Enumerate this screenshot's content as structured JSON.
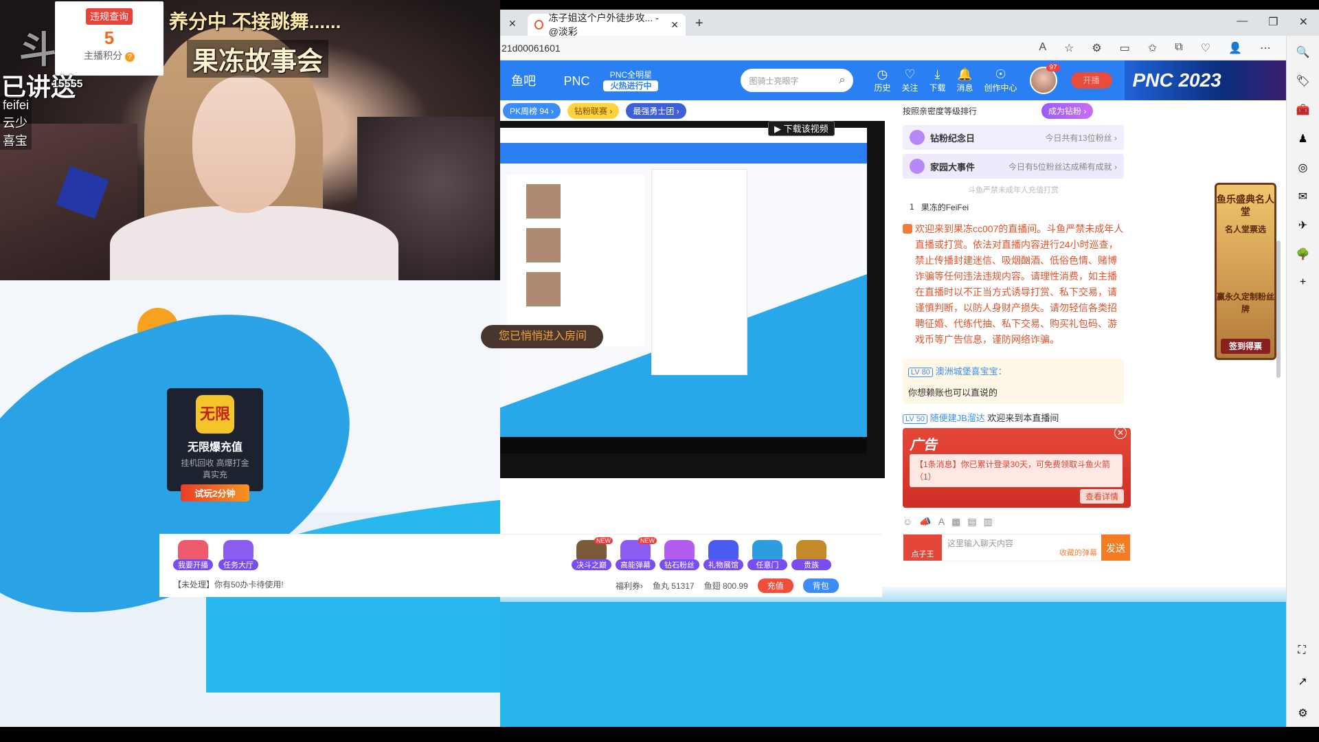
{
  "overlay": {
    "violation_tag": "违规查询",
    "score": "5",
    "score_label": "主播积分",
    "score_help": "?",
    "top_text": "养分中 不接跳舞......",
    "title_text": "果冻故事会",
    "left_text": "已讲送",
    "logo_text": "斗",
    "room_id_text": "15555",
    "names": [
      "feifei",
      "云少",
      "喜宝"
    ]
  },
  "browser": {
    "tab_title": "冻子姐这个户外徒步攻... - @淡彩",
    "new_tab": "+",
    "window_controls": [
      "—",
      "❐",
      "✕"
    ],
    "url": "21d00061601",
    "toolbar_icons": [
      "A",
      "☆",
      "⚙",
      "▭",
      "✩",
      "⧉",
      "♡",
      "👤",
      "⋯"
    ],
    "side_icons": [
      "🔍",
      "🏷",
      "🧰",
      "♟",
      "◎",
      "✉",
      "✈",
      "🌳",
      "+"
    ],
    "side_bottom_icons": [
      "⛶",
      "↗",
      "⚙"
    ]
  },
  "header": {
    "nav": [
      "鱼吧",
      "PNC"
    ],
    "pnc_top": "PNC全明星",
    "pnc_hot": "火热进行中",
    "search_placeholder": "图骑士亮眼字",
    "hnav": [
      {
        "icon": "◷",
        "label": "历史"
      },
      {
        "icon": "♡",
        "label": "关注"
      },
      {
        "icon": "⤓",
        "label": "下载"
      },
      {
        "icon": "🔔",
        "label": "消息"
      },
      {
        "icon": "☉",
        "label": "创作中心"
      }
    ],
    "avatar_badge": "97",
    "live_btn": "开播",
    "banner": "PNC 2023"
  },
  "subbar": {
    "chips": [
      "PK周榜 94 ›",
      "钻粉联赛 ›",
      "最强勇士团 ›"
    ]
  },
  "video": {
    "download_label": "▶ 下载该视频",
    "room_toast": "您已悄悄进入房间"
  },
  "promo_card": {
    "logo": "无限",
    "title": "无限爆充值",
    "line1": "挂机回收  高爆打金",
    "line2": "真实充",
    "cta": "试玩2分钟"
  },
  "rank": {
    "head": "按照亲密度等级排行",
    "become": "成为钻粉 ›",
    "rows": [
      {
        "title": "钻粉纪念日",
        "sub": "今日共有13位粉丝 ›"
      },
      {
        "title": "家园大事件",
        "sub": "今日有5位粉丝达成稀有成就 ›"
      }
    ],
    "note": "斗鱼严禁未成年人充值打赏",
    "first_rank": "1",
    "first_name": "果冻的FeiFei"
  },
  "chat": {
    "notice": "欢迎来到果冻cc007的直播间。斗鱼严禁未成年人直播或打赏。依法对直播内容进行24小时巡查，禁止传播封建迷信、吸烟酗酒、低俗色情、赌博诈骗等任何违法违规内容。请理性消费，如主播在直播时以不正当方式诱导打赏、私下交易，请谨慎判断，以防人身财产损失。请勿轻信各类招聘征婚、代练代抽、私下交易、购买礼包码、游戏币等广告信息，谨防网络诈骗。",
    "msg1": {
      "lv": "LV 80",
      "nick": "澳洲城堡喜宝宝：",
      "text": "你想赖账也可以直说的"
    },
    "msg2": {
      "lv": "LV 50",
      "nick": "随便建JB溜达",
      "text": "欢迎来到本直播间"
    },
    "ad_title": "广告",
    "ad_close": "✕",
    "ad_text": "【1条消息】你已累计登录30天，可免费领取斗鱼火箭（1）",
    "ad_btn": "查看详情",
    "input_tools": [
      "☺",
      "📣",
      "A",
      "▦",
      "▤",
      "▥"
    ],
    "input_placeholder": "这里输入聊天内容",
    "input_fav": "收藏的弹幕",
    "send": "发送",
    "badge": "点子王"
  },
  "event_banner": {
    "title": "鱼乐盛典名人堂",
    "sub": "名人堂票选",
    "badge": "赢永久定制粉丝牌",
    "cta": "签到得票"
  },
  "bottom": {
    "gifts_left": [
      {
        "label": "我要开播",
        "color": "#f05a6d"
      },
      {
        "label": "任务大厅",
        "color": "#8a5cf0"
      }
    ],
    "gifts_right": [
      {
        "label": "决斗之巅",
        "color": "#7b5a3a",
        "new": "NEW"
      },
      {
        "label": "高能弹幕",
        "color": "#8a5cf0",
        "new": "NEW"
      },
      {
        "label": "钻石粉丝",
        "color": "#b45cf0",
        "new": ""
      },
      {
        "label": "礼物展馆",
        "color": "#4a5cf0",
        "new": ""
      },
      {
        "label": "任意门",
        "color": "#2c9ee0",
        "new": ""
      },
      {
        "label": "贵族",
        "color": "#c38a2a",
        "new": ""
      }
    ],
    "notice": "【未处理】你有50办卡待使用!",
    "welfare": "福利券›",
    "fish_ball": "鱼丸 51317",
    "fish_wing": "鱼翅 800.99",
    "recharge": "充值",
    "bag": "背包"
  }
}
